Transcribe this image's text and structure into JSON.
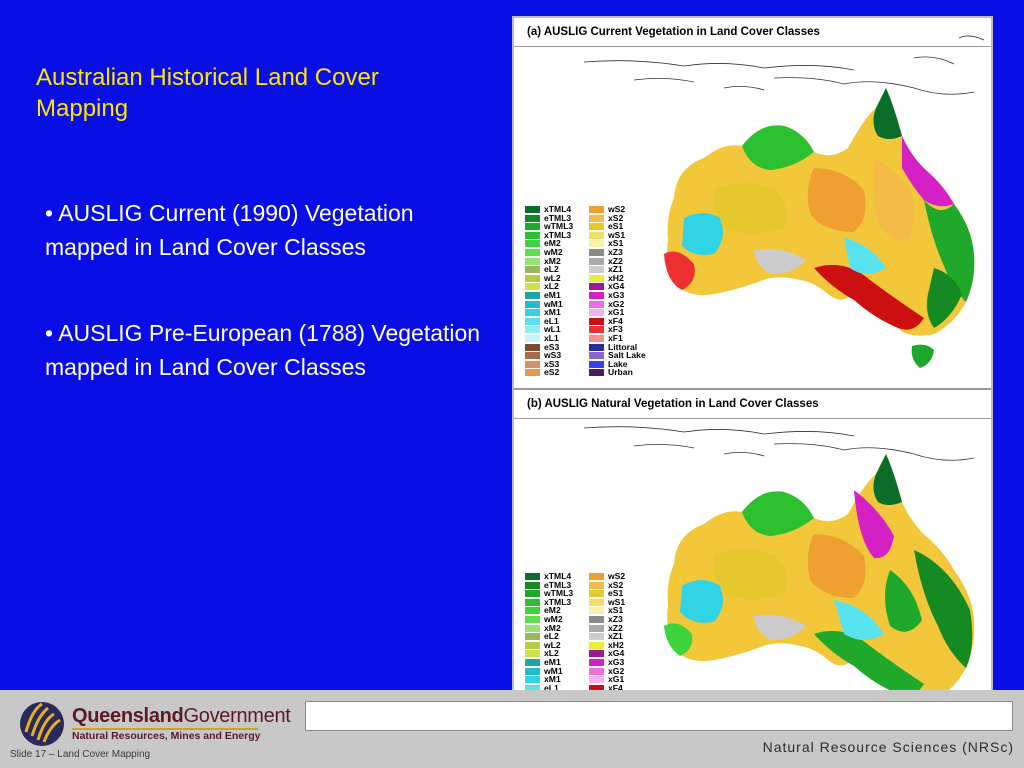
{
  "slide": {
    "title": "Australian Historical Land Cover Mapping",
    "bullets": [
      "• AUSLIG Current (1990) Vegetation mapped in Land Cover Classes",
      "• AUSLIG Pre-European (1788) Vegetation mapped in Land Cover Classes"
    ]
  },
  "maps": [
    {
      "title": "(a) AUSLIG Current Vegetation in Land Cover Classes"
    },
    {
      "title": "(b) AUSLIG Natural Vegetation in Land Cover Classes"
    }
  ],
  "legend": {
    "col1": [
      {
        "label": "xTML4",
        "color": "#0a6e2a"
      },
      {
        "label": "eTML3",
        "color": "#168a22"
      },
      {
        "label": "wTML3",
        "color": "#20a82a"
      },
      {
        "label": "xTML3",
        "color": "#2cc030"
      },
      {
        "label": "eM2",
        "color": "#3cd43a"
      },
      {
        "label": "wM2",
        "color": "#5ee04a"
      },
      {
        "label": "xM2",
        "color": "#8ee870"
      },
      {
        "label": "eL2",
        "color": "#98b85a"
      },
      {
        "label": "wL2",
        "color": "#b4cc44"
      },
      {
        "label": "xL2",
        "color": "#d2e04c"
      },
      {
        "label": "eM1",
        "color": "#1aa6a2"
      },
      {
        "label": "wM1",
        "color": "#22bcc8"
      },
      {
        "label": "xM1",
        "color": "#30d4e4"
      },
      {
        "label": "eL1",
        "color": "#58e2ee"
      },
      {
        "label": "wL1",
        "color": "#8ceef2"
      },
      {
        "label": "xL1",
        "color": "#c4f6f8"
      },
      {
        "label": "eS3",
        "color": "#7a4a2a"
      },
      {
        "label": "wS3",
        "color": "#a86a48"
      },
      {
        "label": "xS3",
        "color": "#d4906a"
      },
      {
        "label": "eS2",
        "color": "#e69a4a"
      }
    ],
    "col2": [
      {
        "label": "wS2",
        "color": "#f0a030"
      },
      {
        "label": "xS2",
        "color": "#f4bc46"
      },
      {
        "label": "eS1",
        "color": "#e6c82e"
      },
      {
        "label": "wS1",
        "color": "#f2dc6a"
      },
      {
        "label": "xS1",
        "color": "#faf0a8"
      },
      {
        "label": "xZ3",
        "color": "#8a8a8a"
      },
      {
        "label": "xZ2",
        "color": "#aaaaaa"
      },
      {
        "label": "xZ1",
        "color": "#cccccc"
      },
      {
        "label": "xH2",
        "color": "#ecec3a"
      },
      {
        "label": "xG4",
        "color": "#a0189a"
      },
      {
        "label": "xG3",
        "color": "#d420c4"
      },
      {
        "label": "xG2",
        "color": "#ee6ee0"
      },
      {
        "label": "xG1",
        "color": "#f6b0ec"
      },
      {
        "label": "xF4",
        "color": "#cc1010"
      },
      {
        "label": "xF3",
        "color": "#ee3030"
      },
      {
        "label": "xF1",
        "color": "#f49090"
      },
      {
        "label": "Littoral",
        "color": "#2a2a9a"
      },
      {
        "label": "Salt Lake",
        "color": "#8866cc"
      },
      {
        "label": "Lake",
        "color": "#3344ee"
      },
      {
        "label": "Urban",
        "color": "#4a1a6a"
      }
    ]
  },
  "footer": {
    "brand_main": "Queensland",
    "brand_gov": "Government",
    "department": "Natural Resources, Mines and Energy",
    "right_text": "Natural Resource Sciences (NRSc)",
    "slide_label": "Slide 17 – Land Cover Mapping"
  },
  "colors": {
    "background": "#0a0ee6",
    "title": "#ffe600",
    "text": "#ffffff",
    "footer": "#c8c8c8",
    "brand": "#5a1a26"
  }
}
